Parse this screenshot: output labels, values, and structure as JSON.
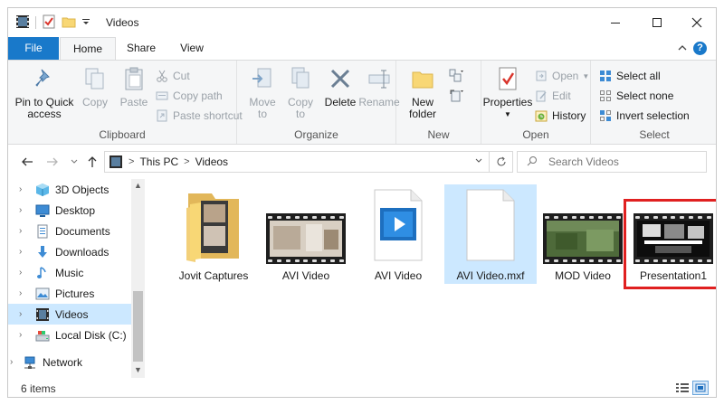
{
  "window": {
    "title": "Videos"
  },
  "tabs": {
    "file": "File",
    "home": "Home",
    "share": "Share",
    "view": "View"
  },
  "ribbon": {
    "clipboard": {
      "label": "Clipboard",
      "pin": "Pin to Quick access",
      "copy": "Copy",
      "paste": "Paste",
      "cut": "Cut",
      "copy_path": "Copy path",
      "paste_shortcut": "Paste shortcut"
    },
    "organize": {
      "label": "Organize",
      "move_to": "Move to",
      "copy_to": "Copy to",
      "delete": "Delete",
      "rename": "Rename"
    },
    "new": {
      "label": "New",
      "new_folder": "New folder"
    },
    "open": {
      "label": "Open",
      "properties": "Properties",
      "open": "Open",
      "edit": "Edit",
      "history": "History"
    },
    "select": {
      "label": "Select",
      "select_all": "Select all",
      "select_none": "Select none",
      "invert": "Invert selection"
    }
  },
  "address": {
    "crumbs": [
      "This PC",
      "Videos"
    ],
    "search_placeholder": "Search Videos"
  },
  "nav": {
    "items": [
      {
        "label": "3D Objects",
        "icon": "cube-icon"
      },
      {
        "label": "Desktop",
        "icon": "desktop-icon"
      },
      {
        "label": "Documents",
        "icon": "documents-icon"
      },
      {
        "label": "Downloads",
        "icon": "download-icon"
      },
      {
        "label": "Music",
        "icon": "music-icon"
      },
      {
        "label": "Pictures",
        "icon": "pictures-icon"
      },
      {
        "label": "Videos",
        "icon": "videos-icon"
      },
      {
        "label": "Local Disk (C:)",
        "icon": "disk-icon"
      },
      {
        "label": "Network",
        "icon": "network-icon"
      }
    ]
  },
  "files": [
    {
      "name": "Jovit Captures",
      "type": "folder"
    },
    {
      "name": "AVI Video",
      "type": "video"
    },
    {
      "name": "AVI Video",
      "type": "video-player"
    },
    {
      "name": "AVI Video.mxf",
      "type": "blank"
    },
    {
      "name": "MOD Video",
      "type": "video"
    },
    {
      "name": "Presentation1",
      "type": "video"
    }
  ],
  "status": {
    "count": "6 items"
  },
  "colors": {
    "accent": "#1979ca",
    "selection": "#cce8ff",
    "highlight_box": "#e02020"
  }
}
